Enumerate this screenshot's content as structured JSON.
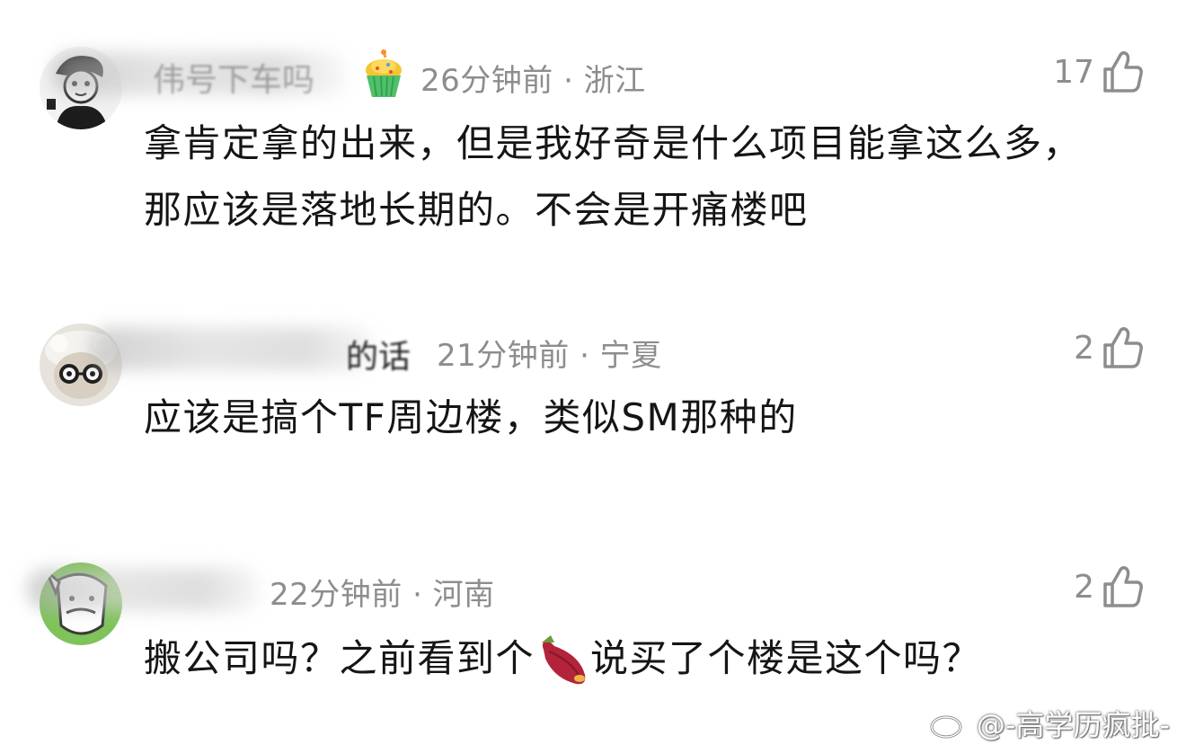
{
  "comments": [
    {
      "name_fragment": "伟号下车吗",
      "meta": "26分钟前 · 浙江",
      "likes": "17",
      "text": "拿肯定拿的出来，但是我好奇是什么项目能拿这么多，那应该是落地长期的。不会是开痛楼吧",
      "badge_icon": "cupcake-icon"
    },
    {
      "name_fragment": "的话",
      "meta": "21分钟前 · 宁夏",
      "likes": "2",
      "text": "应该是搞个TF周边楼，类似SM那种的"
    },
    {
      "name_fragment": "",
      "meta": "22分钟前 · 河南",
      "likes": "2",
      "text_before": "搬公司吗？之前看到个",
      "text_emoji": "sweet-potato-icon",
      "text_after": "说买了个楼是这个吗？"
    }
  ],
  "watermark": {
    "text": "@-高学历疯批-",
    "icon": "weibo-icon"
  },
  "colors": {
    "text": "#151515",
    "meta": "#8d8d8d",
    "background": "#ffffff"
  }
}
